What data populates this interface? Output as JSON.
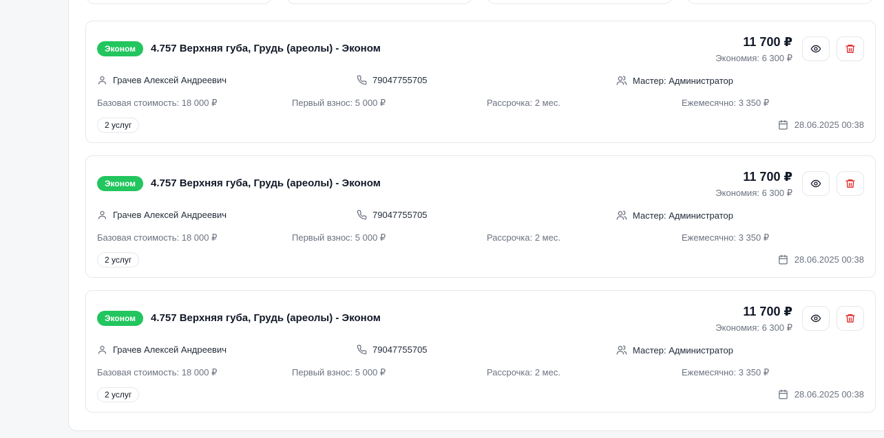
{
  "cards": [
    {
      "badge": "Эконом",
      "title": "4.757 Верхняя губа, Грудь (ареолы) - Эконом",
      "price": "11 700 ₽",
      "savings": "Экономия: 6 300 ₽",
      "client": "Грачев Алексей Андреевич",
      "phone": "79047755705",
      "master": "Мастер: Администратор",
      "base_cost": "Базовая стоимость: 18 000 ₽",
      "first_payment": "Первый взнос: 5 000 ₽",
      "installment": "Рассрочка: 2 мес.",
      "monthly": "Ежемесячно: 3 350 ₽",
      "services": "2 услуг",
      "date": "28.06.2025 00:38"
    },
    {
      "badge": "Эконом",
      "title": "4.757 Верхняя губа, Грудь (ареолы) - Эконом",
      "price": "11 700 ₽",
      "savings": "Экономия: 6 300 ₽",
      "client": "Грачев Алексей Андреевич",
      "phone": "79047755705",
      "master": "Мастер: Администратор",
      "base_cost": "Базовая стоимость: 18 000 ₽",
      "first_payment": "Первый взнос: 5 000 ₽",
      "installment": "Рассрочка: 2 мес.",
      "monthly": "Ежемесячно: 3 350 ₽",
      "services": "2 услуг",
      "date": "28.06.2025 00:38"
    },
    {
      "badge": "Эконом",
      "title": "4.757 Верхняя губа, Грудь (ареолы) - Эконом",
      "price": "11 700 ₽",
      "savings": "Экономия: 6 300 ₽",
      "client": "Грачев Алексей Андреевич",
      "phone": "79047755705",
      "master": "Мастер: Администратор",
      "base_cost": "Базовая стоимость: 18 000 ₽",
      "first_payment": "Первый взнос: 5 000 ₽",
      "installment": "Рассрочка: 2 мес.",
      "monthly": "Ежемесячно: 3 350 ₽",
      "services": "2 услуг",
      "date": "28.06.2025 00:38"
    }
  ],
  "icons": {
    "client": "user-icon",
    "phone": "phone-icon",
    "master": "users-icon",
    "view": "eye-icon",
    "delete": "trash-icon",
    "date": "calendar-icon"
  },
  "colors": {
    "badge": "#22c55e",
    "delete": "#dc2626"
  }
}
